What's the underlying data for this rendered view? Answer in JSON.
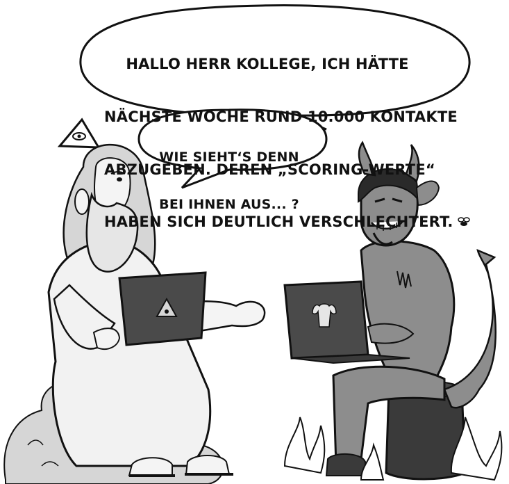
{
  "speech_bubbles": [
    {
      "speaker": "devil",
      "lines": [
        "HALLO HERR KOLLEGE, ICH HÄTTE",
        "NÄCHSTE WOCHE RUND 10.000 KONTAKTE",
        "ABZUGEBEN. DEREN „SCORING-WERTE“",
        "HABEN SICH DEUTLICH VERSCHLECHTERT."
      ]
    },
    {
      "speaker": "god",
      "lines": [
        "WIE SIEHT‘S DENN",
        "BEI IHNEN AUS... ?"
      ]
    }
  ],
  "colors": {
    "ink": "#111111",
    "robe": "#f2f2f2",
    "skin_god": "#f4f4f4",
    "devil_skin": "#8d8d8d",
    "laptop": "#4a4a4a",
    "cloud": "#d6d6d6",
    "stump": "#3a3a3a",
    "flame": "#ffffff"
  },
  "icons": [
    "eye-of-providence-icon",
    "bull-skull-logo-icon",
    "triangle-logo-icon",
    "fly-icon"
  ]
}
